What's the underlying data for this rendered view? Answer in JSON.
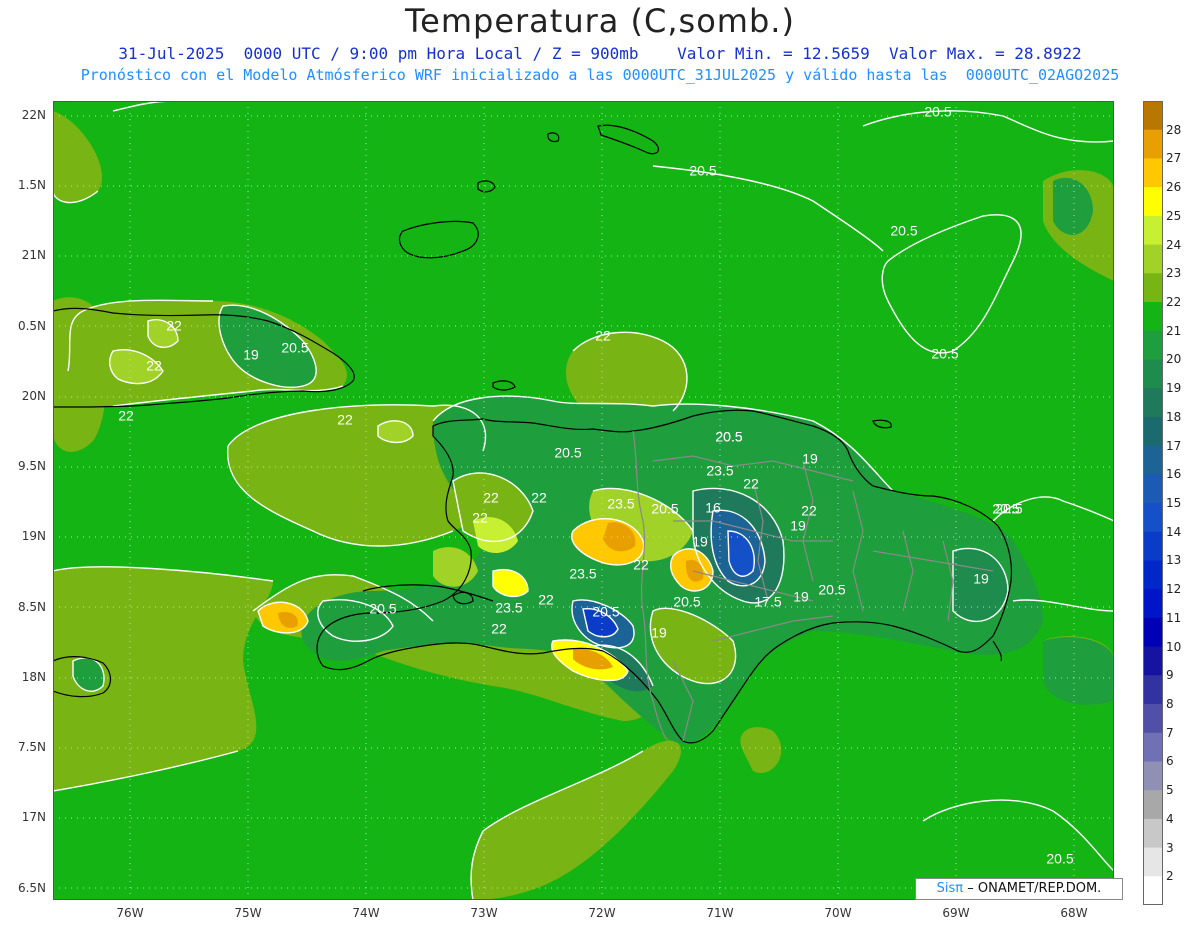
{
  "header": {
    "title": "Temperatura (C,somb.)",
    "line1": "31-Jul-2025  0000 UTC / 9:00 pm Hora Local / Z = 900mb    Valor Min. = 12.5659  Valor Max. = 28.8922",
    "line2": "Pronóstico con el Modelo Atmósferico WRF inicializado a las 0000UTC_31JUL2025 y válido hasta las  0000UTC_02AGO2025"
  },
  "axes": {
    "lat_labels": [
      "22N",
      "1.5N",
      "21N",
      "0.5N",
      "20N",
      "9.5N",
      "19N",
      "8.5N",
      "18N",
      "7.5N",
      "17N",
      "6.5N"
    ],
    "lon_labels": [
      "76W",
      "75W",
      "74W",
      "73W",
      "72W",
      "71W",
      "70W",
      "69W",
      "68W"
    ]
  },
  "colorbar": {
    "labels": [
      "28",
      "27",
      "26",
      "25",
      "24",
      "23",
      "22",
      "21",
      "20",
      "19",
      "18",
      "17",
      "16",
      "15",
      "14",
      "13",
      "12",
      "11",
      "10",
      "9",
      "8",
      "7",
      "6",
      "5",
      "4",
      "3",
      "2"
    ],
    "colors": [
      "#b87800",
      "#e8a000",
      "#ffc800",
      "#ffff00",
      "#c8f032",
      "#a0d228",
      "#78b414",
      "#14b414",
      "#1e9e3c",
      "#1e8c4c",
      "#1e7a5a",
      "#1a6a6e",
      "#1c6496",
      "#1c5ab4",
      "#1450c8",
      "#0a3cc8",
      "#0028c8",
      "#0014c8",
      "#0000b4",
      "#1414a0",
      "#3232a0",
      "#5050a8",
      "#7070b4",
      "#9090b4",
      "#a8a8a8",
      "#c8c8c8",
      "#e6e6e6",
      "#ffffff"
    ]
  },
  "contour_labels": [
    {
      "text": "20.5"
    },
    {
      "text": "20.5"
    },
    {
      "text": "20.5"
    },
    {
      "text": "20.5"
    },
    {
      "text": "20.5"
    },
    {
      "text": "22"
    },
    {
      "text": "22"
    },
    {
      "text": "22"
    },
    {
      "text": "22"
    },
    {
      "text": "22"
    },
    {
      "text": "19"
    },
    {
      "text": "20.5"
    },
    {
      "text": "22"
    },
    {
      "text": "20.5"
    },
    {
      "text": "22"
    },
    {
      "text": "22"
    },
    {
      "text": "23.5"
    },
    {
      "text": "20.5"
    },
    {
      "text": "16"
    },
    {
      "text": "19"
    },
    {
      "text": "20.5"
    },
    {
      "text": "23.5"
    },
    {
      "text": "22"
    },
    {
      "text": "19"
    },
    {
      "text": "22"
    },
    {
      "text": "23.5"
    },
    {
      "text": "22"
    },
    {
      "text": "20.5"
    },
    {
      "text": "19"
    },
    {
      "text": "20.5"
    },
    {
      "text": "17.5"
    },
    {
      "text": "19"
    },
    {
      "text": "20.5"
    },
    {
      "text": "20.5"
    },
    {
      "text": "20.5"
    },
    {
      "text": "23.5"
    },
    {
      "text": "22"
    },
    {
      "text": "22"
    },
    {
      "text": "19"
    },
    {
      "text": "20.5"
    },
    {
      "text": "19"
    },
    {
      "text": "20.5"
    }
  ],
  "credit": {
    "logo": "Sisπ",
    "text": "– ONAMET/REP.DOM."
  }
}
